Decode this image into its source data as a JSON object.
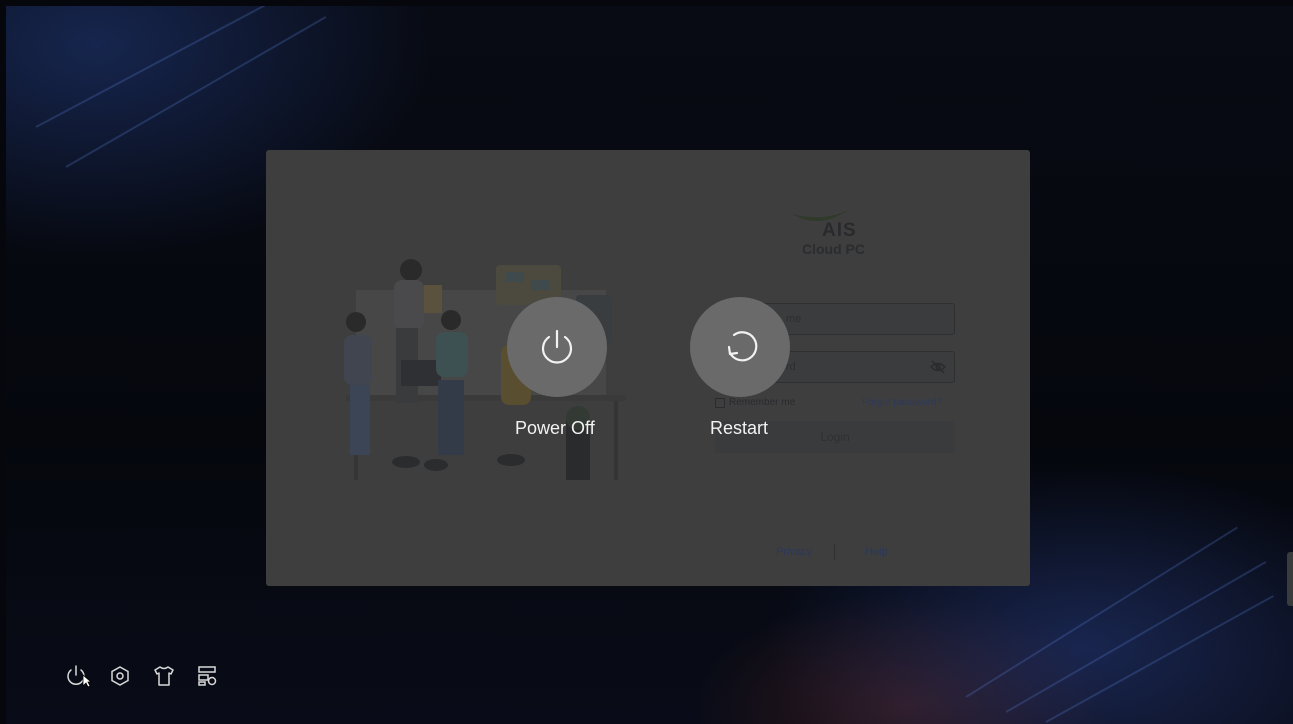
{
  "login_card": {
    "brand_name": "AIS",
    "product_name": "Cloud PC",
    "username_placeholder": "me",
    "password_placeholder": "rd",
    "remember_label": "Remember me",
    "forgot_label": "Forgot password?",
    "login_label": "Login",
    "privacy_label": "Privacy",
    "help_label": "Help"
  },
  "power_menu": {
    "power_off_label": "Power Off",
    "restart_label": "Restart"
  },
  "taskbar": {
    "icons": [
      "power-icon",
      "settings-icon",
      "theme-shirt-icon",
      "network-settings-icon"
    ]
  },
  "colors": {
    "overlay_card": "#3e3e3f",
    "power_button": "#6a6a6b",
    "label_text": "#f2f2f2",
    "link_blue": "#2c3a5c"
  }
}
